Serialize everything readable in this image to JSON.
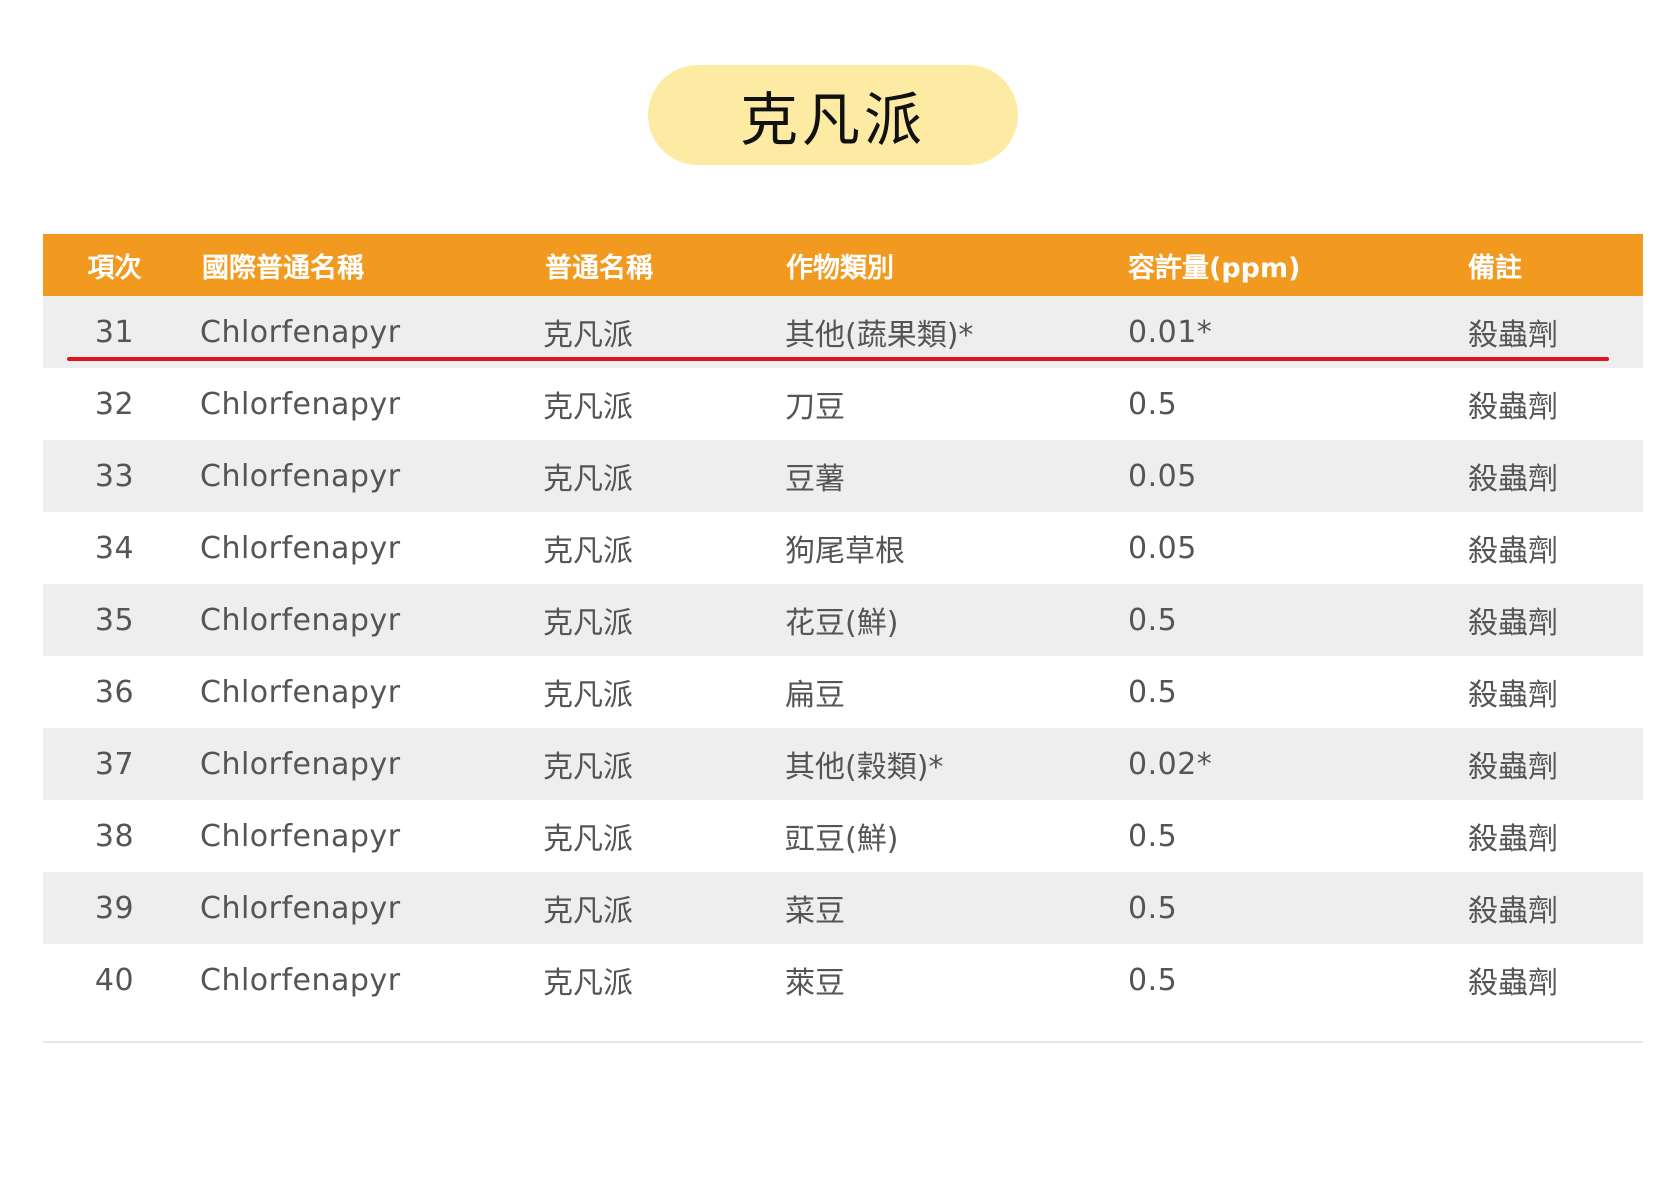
{
  "title": "克凡派",
  "table": {
    "headers": [
      "項次",
      "國際普通名稱",
      "普通名稱",
      "作物類別",
      "容許量(ppm)",
      "備註"
    ],
    "rows": [
      [
        "31",
        "Chlorfenapyr",
        "克凡派",
        "其他(蔬果類)*",
        "0.01*",
        "殺蟲劑"
      ],
      [
        "32",
        "Chlorfenapyr",
        "克凡派",
        "刀豆",
        "0.5",
        "殺蟲劑"
      ],
      [
        "33",
        "Chlorfenapyr",
        "克凡派",
        "豆薯",
        "0.05",
        "殺蟲劑"
      ],
      [
        "34",
        "Chlorfenapyr",
        "克凡派",
        "狗尾草根",
        "0.05",
        "殺蟲劑"
      ],
      [
        "35",
        "Chlorfenapyr",
        "克凡派",
        "花豆(鮮)",
        "0.5",
        "殺蟲劑"
      ],
      [
        "36",
        "Chlorfenapyr",
        "克凡派",
        "扁豆",
        "0.5",
        "殺蟲劑"
      ],
      [
        "37",
        "Chlorfenapyr",
        "克凡派",
        "其他(穀類)*",
        "0.02*",
        "殺蟲劑"
      ],
      [
        "38",
        "Chlorfenapyr",
        "克凡派",
        "豇豆(鮮)",
        "0.5",
        "殺蟲劑"
      ],
      [
        "39",
        "Chlorfenapyr",
        "克凡派",
        "菜豆",
        "0.5",
        "殺蟲劑"
      ],
      [
        "40",
        "Chlorfenapyr",
        "克凡派",
        "萊豆",
        "0.5",
        "殺蟲劑"
      ]
    ],
    "highlighted_row": "31"
  },
  "colors": {
    "header_bg": "#f29a1f",
    "title_bg": "#fdeba4",
    "highlight_line": "#e0141e",
    "row_shade": "#eeeeee"
  }
}
